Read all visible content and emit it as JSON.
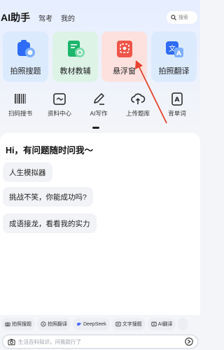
{
  "header": {
    "brand": "AI助手",
    "tabs": [
      "驾考",
      "我的"
    ],
    "search_label": "搜索"
  },
  "cards": [
    {
      "label": "拍照搜题",
      "bg": "#dceafe",
      "icon": "camera-search-icon"
    },
    {
      "label": "教材教辅",
      "bg": "#dcf3e6",
      "icon": "book-search-icon"
    },
    {
      "label": "悬浮窗",
      "bg": "#fde1de",
      "icon": "floating-window-icon"
    },
    {
      "label": "拍照翻译",
      "bg": "#dceafe",
      "icon": "photo-translate-icon"
    }
  ],
  "tools": [
    {
      "label": "扫码搜书",
      "icon": "barcode-icon"
    },
    {
      "label": "资料中心",
      "icon": "folder-icon"
    },
    {
      "label": "AI写作",
      "icon": "pen-icon"
    },
    {
      "label": "上传题库",
      "icon": "cloud-upload-icon"
    },
    {
      "label": "背单词",
      "icon": "word-card-icon"
    }
  ],
  "chat": {
    "greeting": "Hi，有问题随时问我～",
    "suggestions": [
      "人生模拟器",
      "挑战不笑，你能成功吗?",
      "成语接龙，看看我的实力"
    ]
  },
  "chips": [
    {
      "label": "拍照搜题",
      "icon": "camera-icon"
    },
    {
      "label": "拍照翻译",
      "icon": "translate-icon"
    },
    {
      "label": "DeepSeek",
      "icon": "deepseek-icon"
    },
    {
      "label": "文字搜题",
      "icon": "text-search-icon"
    },
    {
      "label": "AI翻译",
      "icon": "ai-translate-icon"
    }
  ],
  "input": {
    "placeholder": "生活百科知识，问我就行了"
  },
  "colors": {
    "accent_blue": "#2f6cf6",
    "accent_green": "#1bb56b",
    "accent_red": "#f0554a",
    "annotation_arrow": "#e8432f"
  }
}
